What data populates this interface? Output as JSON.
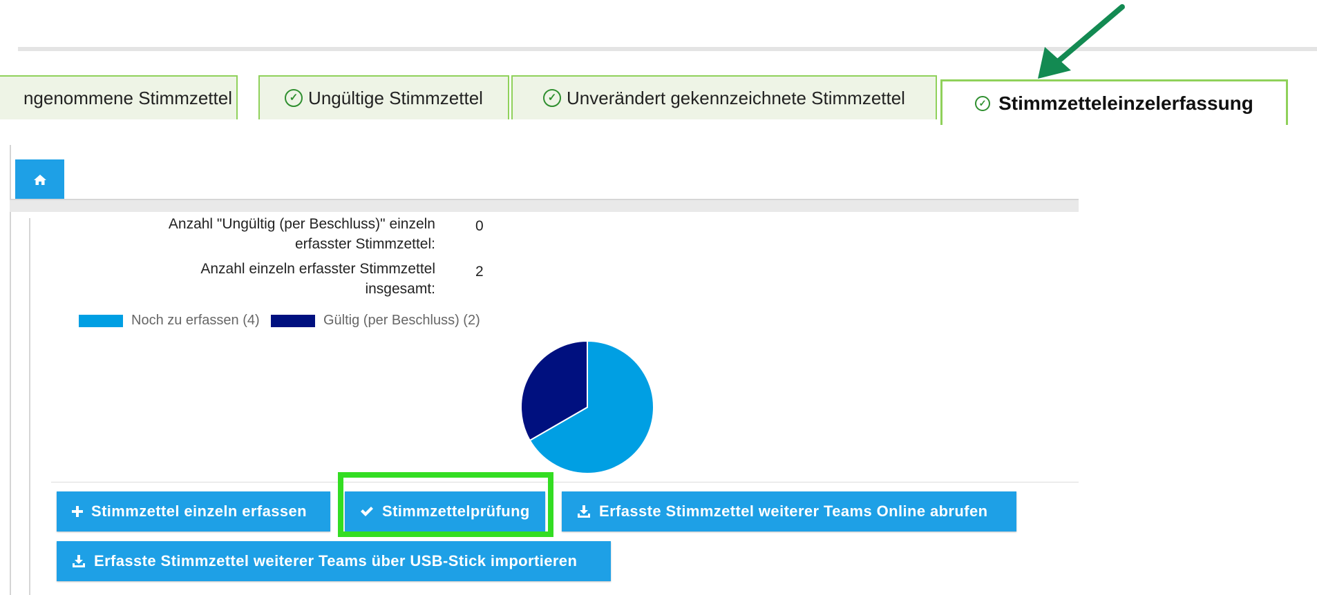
{
  "tabs": [
    {
      "label": "ngenommene Stimmzettel",
      "checked": false
    },
    {
      "label": "Ungültige Stimmzettel",
      "checked": true
    },
    {
      "label": "Unverändert gekennzeichnete Stimmzettel",
      "checked": true
    },
    {
      "label": "Stimmzetteleinzelerfassung",
      "checked": true,
      "active": true
    }
  ],
  "home": {
    "icon": "home-icon"
  },
  "stats": [
    {
      "label": "Anzahl \"Ungültig (per Beschluss)\" einzeln erfasster Stimmzettel:",
      "value": "0"
    },
    {
      "label": "Anzahl einzeln erfasster Stimmzettel insgesamt:",
      "value": "2"
    }
  ],
  "chart_data": {
    "type": "pie",
    "series": [
      {
        "name": "Noch zu erfassen (4)",
        "value": 4,
        "color": "#009fe3"
      },
      {
        "name": "Gültig (per Beschluss) (2)",
        "value": 2,
        "color": "#00107f"
      }
    ],
    "legend_position": "top"
  },
  "buttons": {
    "add_single": "Stimmzettel einzeln erfassen",
    "check": "Stimmzettelprüfung",
    "fetch_online": "Erfasste Stimmzettel weiterer Teams Online abrufen",
    "import_usb": "Erfasste Stimmzettel weiterer Teams über USB-Stick importieren"
  },
  "colors": {
    "primary": "#1ea0e6",
    "tab_border": "#8fd15a",
    "highlight": "#33dd22",
    "arrow": "#138a52"
  }
}
